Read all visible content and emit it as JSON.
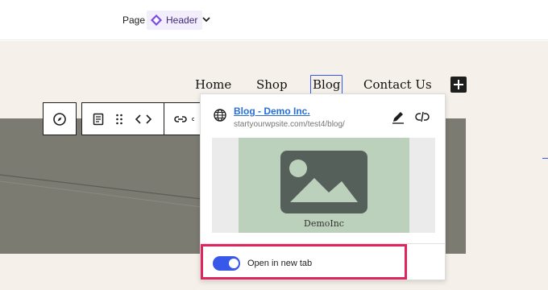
{
  "topbar": {
    "page_label": "Page",
    "template_label": "Header"
  },
  "nav": {
    "items": [
      "Home",
      "Shop",
      "Blog",
      "Contact Us"
    ]
  },
  "popover": {
    "link_title": "Blog - Demo Inc.",
    "link_url": "startyourwpsite.com/test4/blog/",
    "preview_caption": "DemoInc",
    "toggle_label": "Open in new tab",
    "toggle_on": true
  },
  "colors": {
    "accent": "#3858e9",
    "highlight": "#e0245e",
    "template_accent": "#7a46e6",
    "hero": "#7b7b72",
    "canvas": "#f5f1ea"
  }
}
